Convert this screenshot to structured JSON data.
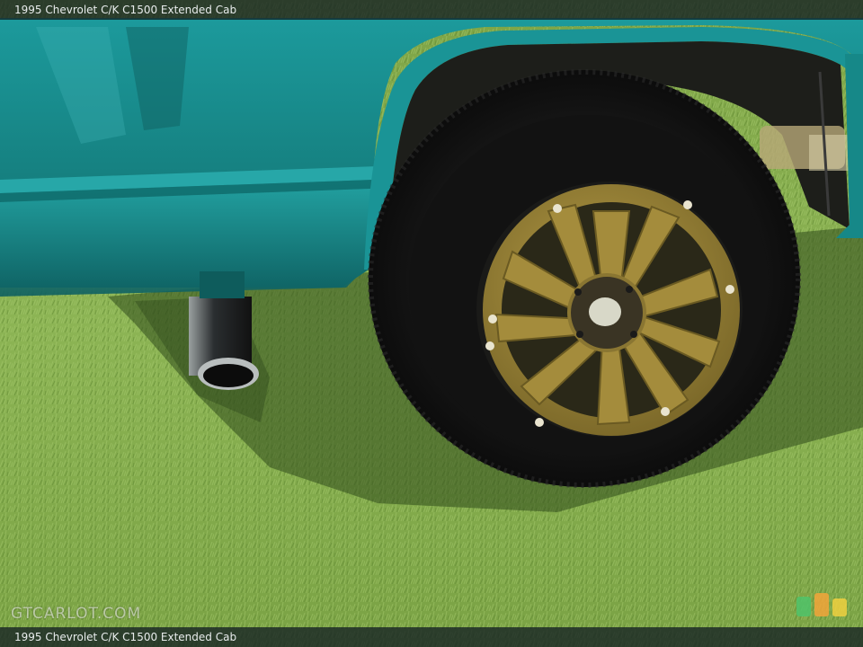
{
  "caption": {
    "top_text": "1995 Chevrolet C/K C1500 Extended Cab",
    "bottom_text": "1995 Chevrolet C/K C1500 Extended Cab"
  },
  "watermark": {
    "text": "GTCARLOT.COM"
  },
  "colors": {
    "body_paint": "#1f8a8a",
    "wheel_bronze": "#9a8436",
    "grass": "#7fa84a",
    "tire": "#151515"
  },
  "icons": {
    "corner_logo": "colored-blocks-logo-icon"
  }
}
